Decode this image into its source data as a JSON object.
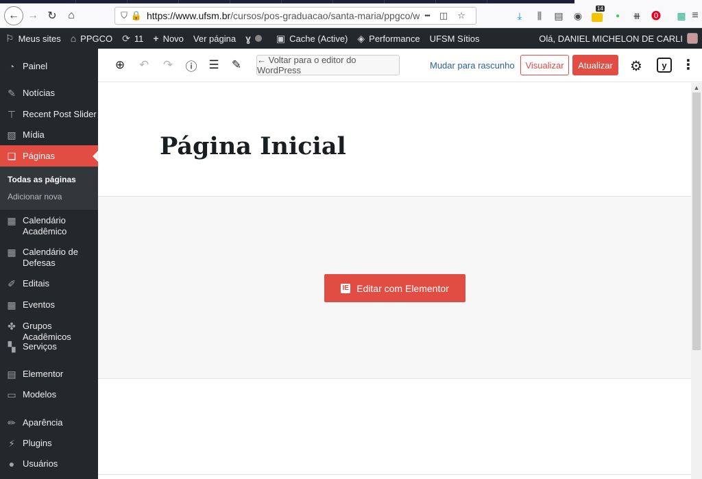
{
  "browser": {
    "url_host": "https://www.ufsm.br",
    "url_path": "/cursos/pos-graduacao/santa-maria/ppgco/wp-adm",
    "overflow_label": "•••",
    "badge_count": "14"
  },
  "adminbar": {
    "my_sites": "Meus sites",
    "site_name": "PPGCO",
    "updates_count": "11",
    "new_label": "Novo",
    "view_page": "Ver página",
    "cache_label": "Cache (Active)",
    "performance_label": "Performance",
    "ufsm_sites": "UFSM Sítios",
    "greeting": "Olá, DANIEL MICHELON DE CARLI"
  },
  "sidebar": {
    "items": [
      {
        "label": "Painel",
        "icon": "dashboard-icon"
      },
      {
        "label": "Notícias",
        "icon": "pin-icon"
      },
      {
        "label": "Recent Post Slider",
        "icon": "thumbtack-icon"
      },
      {
        "label": "Mídia",
        "icon": "media-icon"
      },
      {
        "label": "Páginas",
        "icon": "pages-icon"
      },
      {
        "label": "Calendário Acadêmico",
        "icon": "calendar-icon"
      },
      {
        "label": "Calendário de Defesas",
        "icon": "calendar-icon"
      },
      {
        "label": "Editais",
        "icon": "edit-icon"
      },
      {
        "label": "Eventos",
        "icon": "calendar-icon"
      },
      {
        "label": "Grupos Acadêmicos",
        "icon": "groups-icon"
      },
      {
        "label": "Serviços",
        "icon": "grid-icon"
      },
      {
        "label": "Elementor",
        "icon": "elementor-icon"
      },
      {
        "label": "Modelos",
        "icon": "folder-icon"
      },
      {
        "label": "Aparência",
        "icon": "brush-icon"
      },
      {
        "label": "Plugins",
        "icon": "plugin-icon"
      },
      {
        "label": "Usuários",
        "icon": "user-icon"
      }
    ],
    "submenu": [
      "Todas as páginas",
      "Adicionar nova"
    ]
  },
  "editor": {
    "back_to_wp": "← Voltar para o editor do WordPress",
    "switch_to_draft": "Mudar para rascunho",
    "preview": "Visualizar",
    "update": "Atualizar",
    "yoast_glyph": "y"
  },
  "content": {
    "title": "Página Inicial",
    "elementor_button": "Editar com Elementor",
    "elementor_glyph": "IE"
  },
  "colors": {
    "accent": "#e14d43",
    "admin_dark": "#23282d",
    "link": "#2a6496"
  }
}
